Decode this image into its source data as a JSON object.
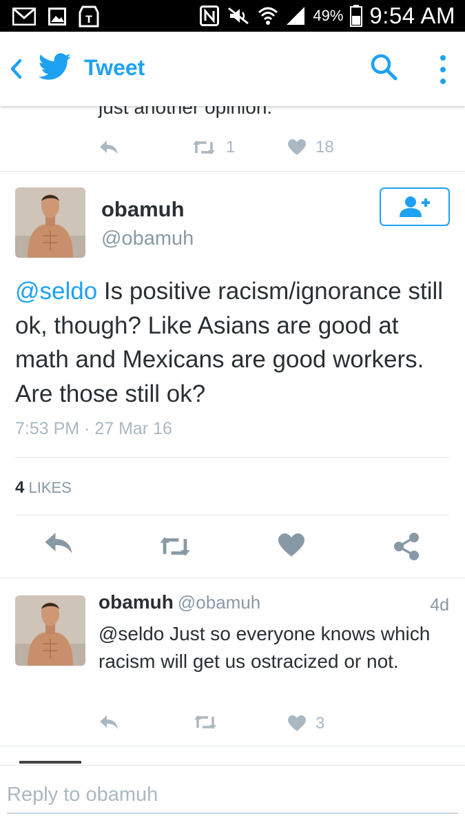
{
  "status_bar": {
    "battery_percent": "49%",
    "time": "9:54 AM",
    "left_icons": [
      "gmail-icon",
      "image-icon",
      "tmobile-icon"
    ],
    "right_icons": [
      "nfc-icon",
      "mute-icon",
      "wifi-icon",
      "signal-icon",
      "battery-icon"
    ]
  },
  "app_bar": {
    "title": "Tweet",
    "accent_color": "#1da1f2"
  },
  "previous_tweet": {
    "text_tail": "just another opinion.",
    "retweets": "1",
    "likes": "18"
  },
  "main_tweet": {
    "name": "obamuh",
    "handle": "@obamuh",
    "mention": "@seldo",
    "text": " Is positive racism/ignorance still ok, though? Like Asians are good at math and Mexicans are good workers. Are those still ok?",
    "timestamp": "7:53 PM · 27 Mar 16",
    "likes_count": "4",
    "likes_label": "LIKES"
  },
  "reply_tweet": {
    "name": "obamuh",
    "handle": "@obamuh",
    "age": "4d",
    "text": "@seldo Just so everyone knows which racism will get us ostracized or not.",
    "retweets": "",
    "likes": "3"
  },
  "composer": {
    "placeholder": "Reply to obamuh"
  }
}
